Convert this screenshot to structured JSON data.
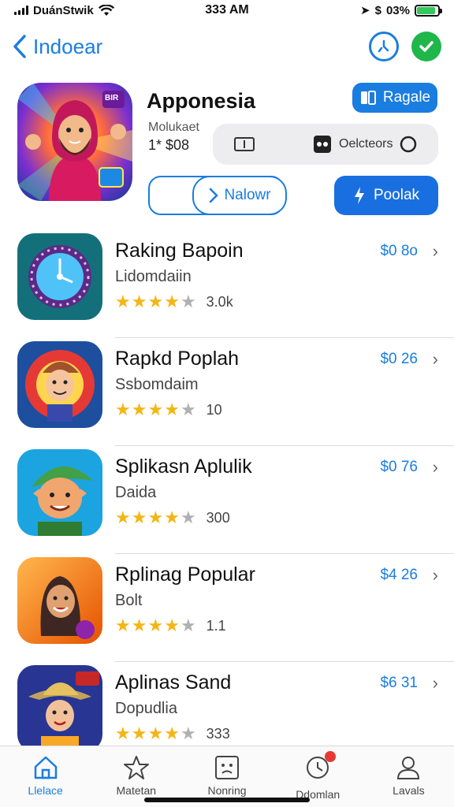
{
  "status_bar": {
    "carrier": "DuánStwik",
    "time": "333 AM",
    "battery_text": "03%",
    "battery_level": 0.9
  },
  "nav": {
    "back_label": "Indoear"
  },
  "featured": {
    "title": "Apponesia",
    "top_button": "Ragale",
    "meta_line1": "Molukaet",
    "meta_line2": "1* $08",
    "segment_option": "Oelcteors",
    "outline_button": "Nalowr",
    "primary_button": "Poolak",
    "icon_badge": "BIR"
  },
  "apps": [
    {
      "name": "Raking Bapoin",
      "subtitle": "Lidomdaiin",
      "rating": 3.5,
      "rating_count": "3.0k",
      "price": "$0 8o"
    },
    {
      "name": "Rapkd Poplah",
      "subtitle": "Ssbomdaim",
      "rating": 3.5,
      "rating_count": "10",
      "price": "$0 26"
    },
    {
      "name": "Splikasn Aplulik",
      "subtitle": "Daida",
      "rating": 3.5,
      "rating_count": "300",
      "price": "$0 76"
    },
    {
      "name": "Rplinag Popular",
      "subtitle": "Bolt",
      "rating": 3.5,
      "rating_count": "1.1",
      "price": "$4 26"
    },
    {
      "name": "Aplinas Sand",
      "subtitle": "Dopudlia",
      "rating": 3.5,
      "rating_count": "333",
      "price": "$6 31"
    }
  ],
  "tabs": [
    {
      "label": "Llelace",
      "icon": "home-icon",
      "active": true
    },
    {
      "label": "Matetan",
      "icon": "star-icon",
      "active": false
    },
    {
      "label": "Nonring",
      "icon": "face-icon",
      "active": false
    },
    {
      "label": "Ddomlan",
      "icon": "clock-badge-icon",
      "active": false
    },
    {
      "label": "Lavals",
      "icon": "person-icon",
      "active": false
    }
  ],
  "colors": {
    "accent": "#1a7de0",
    "success": "#1fb64a",
    "star": "#f3b614"
  }
}
